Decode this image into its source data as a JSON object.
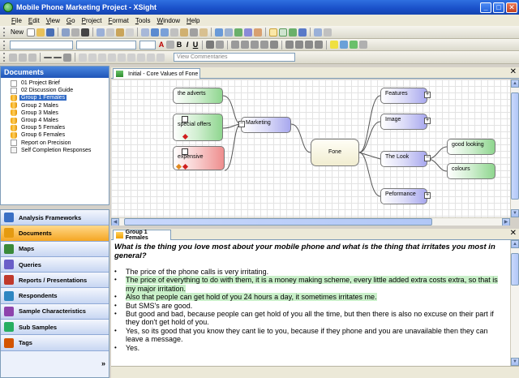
{
  "window": {
    "title": "Mobile Phone Marketing Project - XSight",
    "minimize": "_",
    "maximize": "□",
    "close": "✕"
  },
  "menu": [
    "File",
    "Edit",
    "View",
    "Go",
    "Project",
    "Format",
    "Tools",
    "Window",
    "Help"
  ],
  "toolbar": {
    "new_label": "New",
    "bold": "B",
    "italic": "I",
    "underline": "U",
    "font_color_letter": "A",
    "combo_placeholder": "View Commentaries"
  },
  "documents": {
    "title": "Documents",
    "items": [
      {
        "label": "01 Project Brief",
        "icon": "note-icon",
        "selected": false
      },
      {
        "label": "02 Discussion Guide",
        "icon": "note-icon",
        "selected": false
      },
      {
        "label": "Group 1 Females",
        "icon": "transcript-icon",
        "selected": true
      },
      {
        "label": "Group 2 Males",
        "icon": "transcript-icon",
        "selected": false
      },
      {
        "label": "Group 3 Males",
        "icon": "transcript-icon",
        "selected": false
      },
      {
        "label": "Group 4 Males",
        "icon": "transcript-icon",
        "selected": false
      },
      {
        "label": "Group 5 Females",
        "icon": "transcript-icon",
        "selected": false
      },
      {
        "label": "Group 6 Females",
        "icon": "transcript-icon",
        "selected": false
      },
      {
        "label": "Report on Precision",
        "icon": "note-icon",
        "selected": false
      },
      {
        "label": "Self Completion Responses",
        "icon": "sheet-icon",
        "selected": false
      }
    ]
  },
  "nav": [
    {
      "label": "Analysis Frameworks",
      "color": "#3a6fc4",
      "active": false
    },
    {
      "label": "Documents",
      "color": "#e59a10",
      "active": true
    },
    {
      "label": "Maps",
      "color": "#3a8a3a",
      "active": false
    },
    {
      "label": "Queries",
      "color": "#6a5fc8",
      "active": false
    },
    {
      "label": "Reports / Presentations",
      "color": "#c0392b",
      "active": false
    },
    {
      "label": "Respondents",
      "color": "#2e86c1",
      "active": false
    },
    {
      "label": "Sample Characteristics",
      "color": "#8e44ad",
      "active": false
    },
    {
      "label": "Sub Samples",
      "color": "#27ae60",
      "active": false
    },
    {
      "label": "Tags",
      "color": "#d35400",
      "active": false
    }
  ],
  "nav_more": "»",
  "map": {
    "tab_label": "Initial - Core Values of Fone",
    "nodes": {
      "adverts": "the adverts",
      "special_offers": "special offers",
      "expensive": "expensive",
      "marketing": "Marketing",
      "center": "Fone",
      "features": "Features",
      "image": "Image",
      "the_look": "The Look",
      "performance": "Peformance",
      "good_looking": "good looking",
      "colours": "colours"
    }
  },
  "transcript": {
    "tab_label": "Group 1 Females",
    "question": "What is the thing you love most about your mobile phone and what is the thing that irritates you most in general?",
    "bullets": [
      {
        "text": "The price of the phone calls is very irritating.",
        "highlighted": false
      },
      {
        "text": "The price of everything to do with them, it is a money making scheme, every little added extra costs extra, so that is my major irritation.",
        "highlighted": true
      },
      {
        "text": "Also that people can get hold of you 24 hours a day, it sometimes irritates me.",
        "highlighted": true
      },
      {
        "text": "But SMS's are good.",
        "highlighted": false
      },
      {
        "text": "But good and bad, because people can get hold of you all the time, but then there is also no excuse on their part if they don't get hold of you.",
        "highlighted": false
      },
      {
        "text": "Yes, so its good that you know they cant lie to you, because if they phone and you are unavailable then they can leave a message.",
        "highlighted": false
      },
      {
        "text": "Yes.",
        "highlighted": false
      }
    ]
  }
}
